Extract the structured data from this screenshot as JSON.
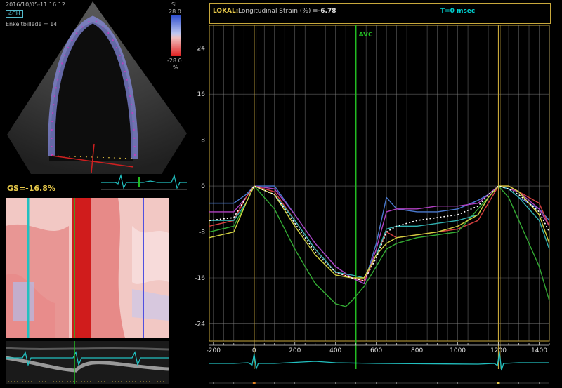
{
  "echo": {
    "timestamp": "2016/10/05-11:16:12",
    "view": "4CH",
    "frame_label": "Enkeltbillede = 14",
    "scale_title": "SL",
    "scale_max": "28.0",
    "scale_min": "-28.0",
    "scale_unit": "%",
    "global_strain": "GS=-16.8%"
  },
  "header": {
    "lokal": "LOKAL:",
    "title": "Longitudinal Strain (%)",
    "value": "=-6.78",
    "time": "T=0 msec"
  },
  "chart": {
    "avc_label": "AVC",
    "colors": {
      "border": "#c8a83c",
      "grid": "#8a8a8a",
      "avc": "#22bb22",
      "ecg": "#22c0c0"
    }
  },
  "chart_data": {
    "type": "line",
    "xlim": [
      -220,
      1450
    ],
    "ylim": [
      -27,
      28
    ],
    "xticks": [
      -200,
      0,
      200,
      400,
      600,
      800,
      1000,
      1200,
      1400
    ],
    "yticks": [
      24,
      16,
      8,
      0,
      -8,
      -16,
      -24
    ],
    "xticklabels": [
      "-200",
      "0",
      "200",
      "400",
      "600",
      "800",
      "1000",
      "1200",
      "1400"
    ],
    "yticklabels": [
      "24",
      "16",
      "8",
      "0",
      "-8",
      "-16",
      "-24"
    ],
    "avc": 500,
    "markers": [
      0,
      1200
    ],
    "series": [
      {
        "color": "#4a7ad0",
        "x": [
          -220,
          -100,
          -40,
          0,
          100,
          200,
          300,
          400,
          480,
          540,
          600,
          650,
          700,
          800,
          900,
          1000,
          1100,
          1150,
          1200,
          1250,
          1300,
          1400,
          1450
        ],
        "y": [
          -3,
          -3,
          -1.5,
          0,
          0,
          -5,
          -10,
          -14,
          -16,
          -17,
          -10,
          -2,
          -4,
          -4.5,
          -4.5,
          -4,
          -2.5,
          -1.5,
          0,
          -0.5,
          -2,
          -4,
          -6
        ]
      },
      {
        "color": "#b040c0",
        "x": [
          -220,
          -100,
          -40,
          0,
          100,
          200,
          300,
          400,
          480,
          540,
          600,
          650,
          700,
          800,
          900,
          1000,
          1100,
          1150,
          1200,
          1250,
          1300,
          1400,
          1450
        ],
        "y": [
          -4.5,
          -4.5,
          -2,
          0,
          -0.5,
          -5,
          -10,
          -14,
          -16,
          -17,
          -11,
          -4.5,
          -4,
          -4,
          -3.5,
          -3.5,
          -3,
          -1.5,
          0,
          -0.5,
          -1,
          -4,
          -7
        ]
      },
      {
        "color": "#d84040",
        "x": [
          -220,
          -100,
          -40,
          0,
          100,
          200,
          300,
          400,
          480,
          540,
          600,
          650,
          700,
          800,
          900,
          1000,
          1100,
          1150,
          1200,
          1250,
          1300,
          1400,
          1450
        ],
        "y": [
          -7,
          -6,
          -2,
          0,
          -1,
          -6,
          -11,
          -15,
          -16,
          -16.5,
          -12,
          -8,
          -9,
          -8.5,
          -8,
          -7.5,
          -6,
          -3,
          0,
          0,
          -1,
          -3,
          -7
        ]
      },
      {
        "color": "#33aa33",
        "x": [
          -220,
          -100,
          -40,
          0,
          100,
          200,
          300,
          400,
          450,
          480,
          540,
          600,
          650,
          700,
          800,
          900,
          1000,
          1100,
          1150,
          1200,
          1250,
          1300,
          1400,
          1450
        ],
        "y": [
          -8,
          -7,
          -3,
          0,
          -4,
          -11,
          -17,
          -20.5,
          -21,
          -20,
          -17.5,
          -14,
          -11,
          -10,
          -9,
          -8.5,
          -8,
          -4,
          -2,
          0,
          -2,
          -6,
          -14,
          -20
        ]
      },
      {
        "color": "#30b0b0",
        "x": [
          -220,
          -100,
          -40,
          0,
          100,
          200,
          300,
          400,
          480,
          540,
          600,
          650,
          700,
          800,
          900,
          1000,
          1100,
          1150,
          1200,
          1250,
          1300,
          1400,
          1450
        ],
        "y": [
          -6,
          -6,
          -3,
          0,
          -1.5,
          -6,
          -11,
          -15,
          -15.5,
          -16,
          -12,
          -7.5,
          -7,
          -7,
          -6.5,
          -6,
          -5,
          -2,
          0,
          -0.5,
          -2,
          -6,
          -11
        ]
      },
      {
        "color": "#d0d040",
        "x": [
          -220,
          -100,
          -40,
          0,
          100,
          200,
          300,
          400,
          480,
          540,
          600,
          650,
          700,
          800,
          900,
          1000,
          1100,
          1150,
          1200,
          1250,
          1300,
          1400,
          1450
        ],
        "y": [
          -9,
          -8,
          -3,
          0,
          -1.5,
          -7,
          -12,
          -15.5,
          -16,
          -16,
          -12,
          -10,
          -9,
          -8.5,
          -8,
          -7,
          -5,
          -2,
          0,
          0,
          -1,
          -5,
          -10
        ]
      },
      {
        "color": "#ffffff",
        "dash": true,
        "x": [
          -220,
          -100,
          -40,
          0,
          100,
          200,
          300,
          400,
          480,
          540,
          600,
          650,
          700,
          800,
          900,
          1000,
          1100,
          1150,
          1200,
          1250,
          1300,
          1400,
          1450
        ],
        "y": [
          -6,
          -5.5,
          -2,
          0,
          -1.5,
          -6.5,
          -11.5,
          -15,
          -16,
          -16.5,
          -12.5,
          -8,
          -7,
          -6,
          -5.5,
          -5,
          -3.5,
          -1.5,
          0,
          -0.5,
          -1.5,
          -4.5,
          -8
        ]
      }
    ]
  }
}
